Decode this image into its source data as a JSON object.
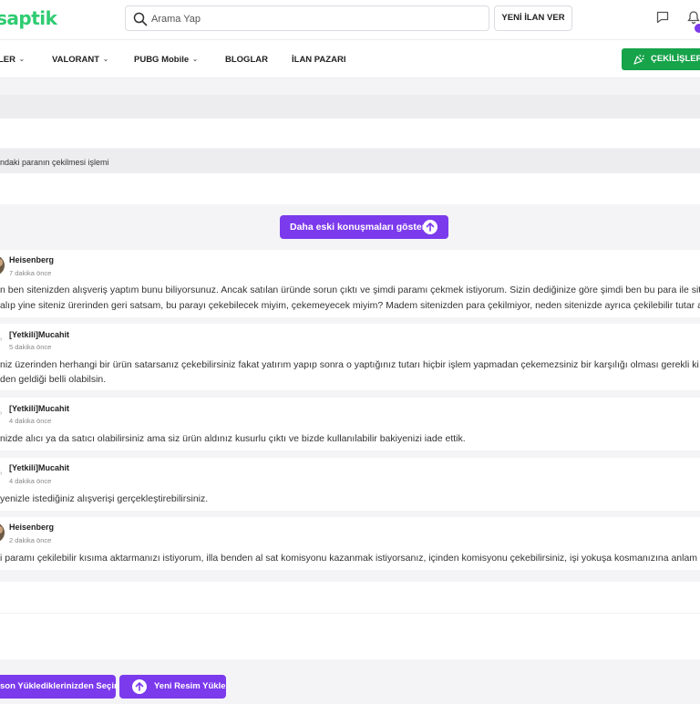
{
  "header": {
    "logo": "saptik",
    "search_placeholder": "Arama Yap",
    "post_button": "YENİ İLAN VER",
    "icons": [
      "chat-icon",
      "bell-icon"
    ]
  },
  "nav": {
    "items": [
      {
        "label": "LER",
        "has_dropdown": true
      },
      {
        "label": "VALORANT",
        "has_dropdown": true
      },
      {
        "label": "PUBG Mobile",
        "has_dropdown": true
      },
      {
        "label": "BLOGLAR",
        "has_dropdown": false
      },
      {
        "label": "İLAN PAZARI",
        "has_dropdown": false
      }
    ],
    "giveaway_button": "ÇEKİLİŞLER"
  },
  "ticket": {
    "subject": "ndaki paranın çekilmesi işlemi"
  },
  "older_button": "Daha eski konuşmaları göster",
  "messages": [
    {
      "author": "Heisenberg",
      "time": "7 dakika önce",
      "lines": [
        "n ben sitenizden alışveriş yaptım bunu biliyorsunuz. Ancak satılan üründe sorun çıktı ve şimdi paramı çekmek istiyorum. Sizin dediğinize göre şimdi ben bu para ile siten",
        "alıp yine siteniz ürerinden geri satsam, bu parayı çekebilecek miyim, çekemeyecek miyim? Madem sitenizden para çekilmiyor, neden sitenizde ayrıca çekilebilir tutar ala"
      ]
    },
    {
      "author": "[Yetkili]Mucahit",
      "time": "5 dakika önce",
      "lines": [
        "niz üzerinden herhangi bir ürün satarsanız çekebilirsiniz fakat yatırım yapıp sonra o yaptığınız tutarı hiçbir işlem yapmadan çekemezsiniz bir karşılığı olması gerekli ki pa",
        "den geldiği belli olabilsin."
      ]
    },
    {
      "author": "[Yetkili]Mucahit",
      "time": "4 dakika önce",
      "lines": [
        "nizde alıcı ya da satıcı olabilirsiniz ama siz ürün aldınız kusurlu çıktı ve bizde kullanılabilir bakiyenizi iade ettik."
      ]
    },
    {
      "author": "[Yetkili]Mucahit",
      "time": "4 dakika önce",
      "lines": [
        "yenizle istediğiniz alışverişi gerçekleştirebilirsiniz."
      ]
    },
    {
      "author": "Heisenberg",
      "time": "2 dakika önce",
      "lines": [
        "i paramı çekilebilir kısıma aktarmanızı istiyorum, illa benden al sat komisyonu kazanmak istiyorsanız, içinden komisyonu çekebilirsiniz, işi yokuşa kosmanızına anlam ver"
      ]
    }
  ],
  "bottom": {
    "choose_button": "son Yüklediklerinizden Seçin",
    "upload_button": "Yeni Resim Yükle"
  },
  "colors": {
    "accent": "#7c3aed",
    "green": "#16a34a",
    "logo": "#2ecc71"
  }
}
